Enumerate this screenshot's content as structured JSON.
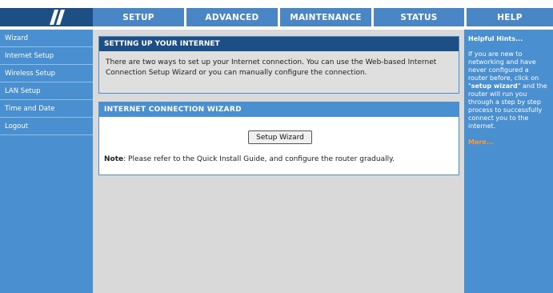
{
  "nav": {
    "tabs": [
      {
        "label": "SETUP"
      },
      {
        "label": "ADVANCED"
      },
      {
        "label": "MAINTENANCE"
      },
      {
        "label": "STATUS"
      },
      {
        "label": "HELP"
      }
    ]
  },
  "sidebar": {
    "items": [
      {
        "label": "Wizard"
      },
      {
        "label": "Internet Setup"
      },
      {
        "label": "Wireless Setup"
      },
      {
        "label": "LAN Setup"
      },
      {
        "label": "Time and Date"
      },
      {
        "label": "Logout"
      }
    ]
  },
  "main": {
    "setup_section": {
      "title": "SETTING UP YOUR INTERNET",
      "text": "There are two ways to set up your Internet connection. You can use the Web-based Internet Connection Setup Wizard or you can manually configure the connection."
    },
    "wizard_section": {
      "title": "INTERNET CONNECTION WIZARD",
      "button_label": "Setup Wizard",
      "note_label": "Note",
      "note_text": ": Please refer to the Quick Install Guide, and configure the router gradually."
    }
  },
  "hints": {
    "title": "Helpful Hints...",
    "text_part1": "If you are new to networking and have never configured a router before, click on \"",
    "text_bold": "setup wizard",
    "text_part2": "\" and the router will run you through a step by step process to successfully connect you to the internet.",
    "more_label": "More..."
  },
  "colors": {
    "nav_tab": "#4a86c6",
    "sidebar": "#4a8fd0",
    "dark_header": "#1d4f85",
    "more_link": "#ff9a2e"
  }
}
